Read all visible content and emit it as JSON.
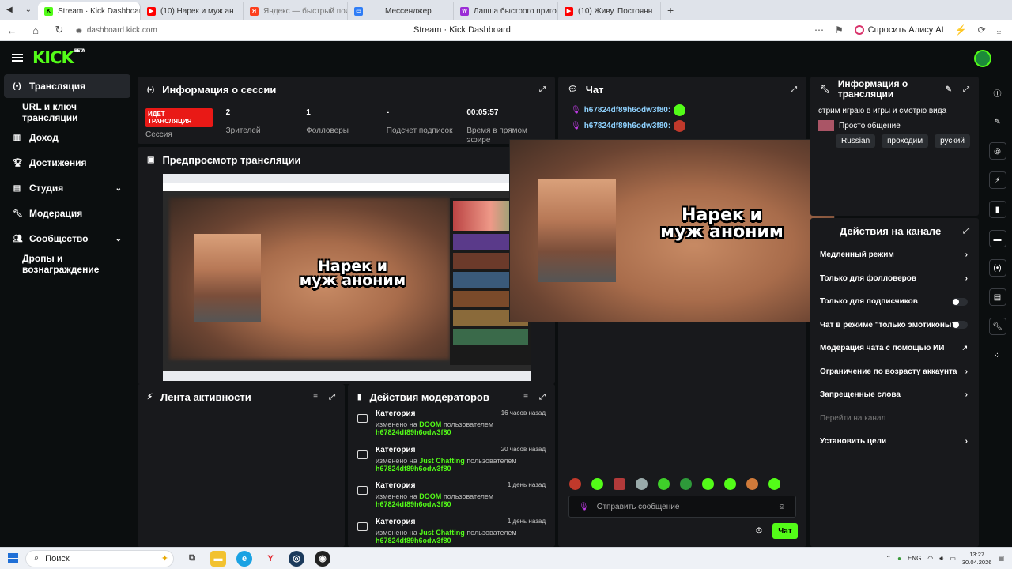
{
  "browser": {
    "tabs": [
      {
        "title": "Stream · Kick Dashboar",
        "favicon_color": "#53fc18",
        "active": true
      },
      {
        "title": "(10) Нарек и муж ан",
        "favicon_color": "#ff0000",
        "active": false
      },
      {
        "title": "Яндекс — быстрый поиск",
        "favicon_color": "#fc3f1d",
        "active": false
      },
      {
        "title": "Мессенджер",
        "favicon_color": "#2f7df6",
        "active": false
      },
      {
        "title": "Лапша быстрого пригото",
        "favicon_color": "#9b2cd6",
        "active": false
      },
      {
        "title": "(10) Живу. Постоянн",
        "favicon_color": "#ff0000",
        "active": false
      }
    ],
    "url": "dashboard.kick.com",
    "page_title": "Stream · Kick Dashboard",
    "alice_label": "Спросить Алису AI"
  },
  "kick": {
    "logo": "KICK",
    "logo_badge": "BETA",
    "accent": "#53fc18"
  },
  "sidebar": {
    "items": [
      {
        "label": "Трансляция",
        "icon": "broadcast-icon"
      },
      {
        "label": "URL и ключ трансляции",
        "icon": ""
      },
      {
        "label": "Доход",
        "icon": "chart-icon"
      },
      {
        "label": "Достижения",
        "icon": "trophy-icon"
      },
      {
        "label": "Студия",
        "icon": "studio-icon"
      },
      {
        "label": "Модерация",
        "icon": "wrench-icon"
      },
      {
        "label": "Сообщество",
        "icon": "people-icon"
      },
      {
        "label": "Дропы и вознаграждение",
        "icon": ""
      }
    ]
  },
  "session": {
    "title": "Информация о сессии",
    "live_badge": "ИДЕТ ТРАНСЛЯЦИЯ",
    "live_sub": "Сессия",
    "stats": [
      {
        "value": "2",
        "label": "Зрителей"
      },
      {
        "value": "1",
        "label": "Фолловеры"
      },
      {
        "value": "-",
        "label": "Подсчет подписок"
      },
      {
        "value": "00:05:57",
        "label": "Время в прямом эфире"
      }
    ]
  },
  "preview": {
    "title": "Предпросмотр трансляции",
    "overlay_text_line1": "Нарек и",
    "overlay_text_line2": "муж аноним"
  },
  "chat": {
    "title": "Чат",
    "messages": [
      {
        "user": "h67824df89h6odw3f80:"
      },
      {
        "user": "h67824df89h6odw3f80:"
      }
    ],
    "input_placeholder": "Отправить сообщение",
    "send_label": "Чат"
  },
  "stream_info": {
    "title": "Информация о трансляции",
    "stream_title": "стрим играю в игры и смотрю вида",
    "category": "Просто общение",
    "tags": [
      "Russian",
      "проходим",
      "руский"
    ]
  },
  "channel_actions": {
    "title": "Действия на канале",
    "rows": [
      {
        "label": "Медленный режим",
        "control": "chevron"
      },
      {
        "label": "Только для фолловеров",
        "control": "chevron"
      },
      {
        "label": "Только для подписчиков",
        "control": "toggle"
      },
      {
        "label": "Чат в режиме \"только эмотиконы\"",
        "control": "toggle"
      },
      {
        "label": "Модерация чата с помощью ИИ",
        "control": "external"
      },
      {
        "label": "Ограничение по возрасту аккаунта",
        "control": "chevron"
      },
      {
        "label": "Запрещенные слова",
        "control": "chevron"
      },
      {
        "label": "Перейти на канал",
        "control": "none"
      },
      {
        "label": "Установить цели",
        "control": "chevron"
      }
    ]
  },
  "activity": {
    "title": "Лента активности"
  },
  "mod_actions": {
    "title": "Действия модераторов",
    "items": [
      {
        "title": "Категория",
        "time": "16 часов назад",
        "prefix": "изменено на",
        "value": "DOOM",
        "by": "пользователем",
        "user": "h67824df89h6odw3f80"
      },
      {
        "title": "Категория",
        "time": "20 часов назад",
        "prefix": "изменено на",
        "value": "Just Chatting",
        "by": "пользователем",
        "user": "h67824df89h6odw3f80"
      },
      {
        "title": "Категория",
        "time": "1 день назад",
        "prefix": "изменено на",
        "value": "DOOM",
        "by": "пользователем",
        "user": "h67824df89h6odw3f80"
      },
      {
        "title": "Категория",
        "time": "1 день назад",
        "prefix": "изменено на",
        "value": "Just Chatting",
        "by": "пользователем",
        "user": "h67824df89h6odw3f80"
      }
    ]
  },
  "taskbar": {
    "search_label": "Поиск",
    "lang": "ENG",
    "time": "13:27",
    "date": "30.04.2026"
  }
}
